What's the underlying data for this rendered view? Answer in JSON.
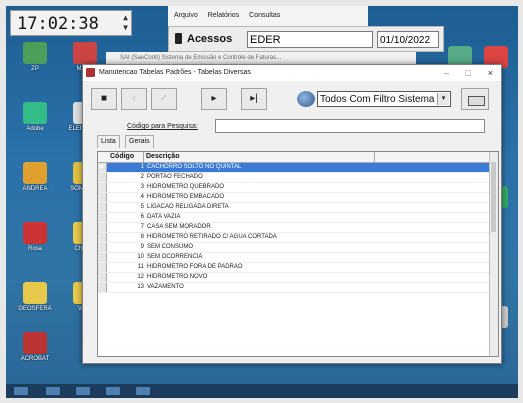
{
  "clock": {
    "time": "17:02:38"
  },
  "top_menu": [
    "Arquivo",
    "Relatórios",
    "Consultas"
  ],
  "acessos": {
    "label": "Acessos",
    "user": "EDER",
    "date": "01/10/2022"
  },
  "behind_window": {
    "title": "SAI (SaeConti) Sistema de Emissão e Controle de Faturas..."
  },
  "window": {
    "title": "Manutencao Tabelas Padrões - Tabelas Diversas",
    "controls": {
      "minimize": "–",
      "maximize": "□",
      "close": "×"
    }
  },
  "toolbar": {
    "buttons": [
      "■",
      "‹",
      "✓",
      "▸",
      "▸|"
    ],
    "filter_value": "Todos Com Filtro Sistema",
    "filter_arrow": "▾"
  },
  "search": {
    "label": "Código para Pesquisa:",
    "value": ""
  },
  "tabs": [
    "Lista",
    "Gerais"
  ],
  "grid": {
    "columns": [
      "Código",
      "Descrição"
    ],
    "rows": [
      {
        "code": "1",
        "desc": "CACHORRO SOLTO NO QUINTAL"
      },
      {
        "code": "2",
        "desc": "PORTAO FECHADO"
      },
      {
        "code": "3",
        "desc": "HIDROMETRO QUEBRADO"
      },
      {
        "code": "4",
        "desc": "HIDROMETRO EMBACADO"
      },
      {
        "code": "5",
        "desc": "LIGACAO RELIGADA DIRETA"
      },
      {
        "code": "6",
        "desc": "DATA VAZIA"
      },
      {
        "code": "7",
        "desc": "CASA SEM MORADOR"
      },
      {
        "code": "8",
        "desc": "HIDROMETRO RETIRADO C/ AGUA CORTADA"
      },
      {
        "code": "9",
        "desc": "SEM CONSUMO"
      },
      {
        "code": "10",
        "desc": "SEM OCORRENCIA"
      },
      {
        "code": "11",
        "desc": "HIDROMETRO FORA DE PADRAO"
      },
      {
        "code": "12",
        "desc": "HIDROMETRO NOVO"
      },
      {
        "code": "13",
        "desc": "VAZAMENTO"
      }
    ],
    "selected_index": 0,
    "row_indicator": "▶"
  },
  "desktop_icons": [
    "ZP",
    "MAPS",
    "Adobe",
    "ELEITORAL",
    "ANDREA",
    "SOMENTE",
    "Rosa",
    "Chrome",
    "GEOSFERA",
    "Vazio",
    "ACROBAT"
  ],
  "colors": {
    "selection": "#3a7bd5",
    "desktop": "#2b72ab"
  }
}
